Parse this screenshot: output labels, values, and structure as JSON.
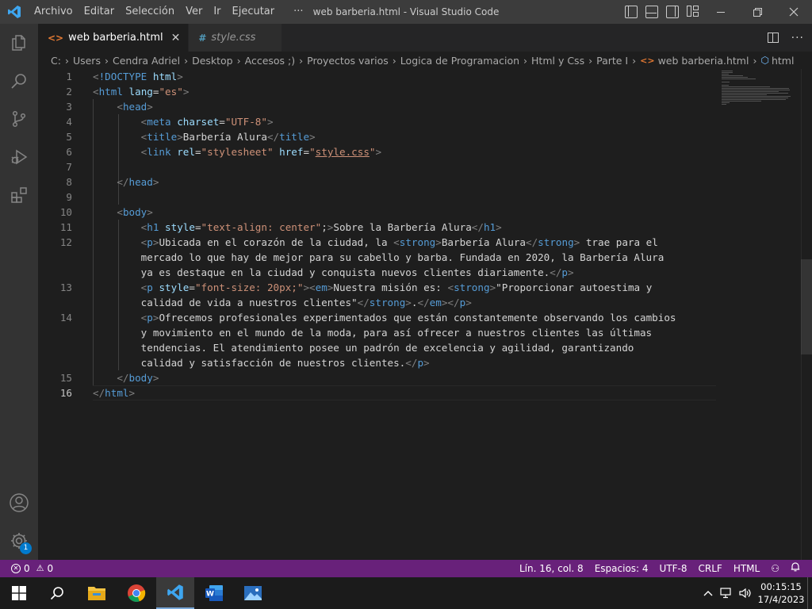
{
  "titlebar": {
    "title": "web barberia.html - Visual Studio Code",
    "menus": [
      "Archivo",
      "Editar",
      "Selección",
      "Ver",
      "Ir",
      "Ejecutar",
      "···"
    ]
  },
  "tabs": [
    {
      "label": "web barberia.html",
      "icon": "html-file-icon",
      "active": true,
      "icon_color": "#e37933"
    },
    {
      "label": "style.css",
      "icon": "css-file-icon",
      "active": false,
      "icon_color": "#519aba"
    }
  ],
  "breadcrumb": [
    "C:",
    "Users",
    "Cendra Adriel",
    "Desktop",
    "Accesos ;)",
    "Proyectos varios",
    "Logica de Programacion",
    "Html y Css",
    "Parte I",
    "web barberia.html",
    "html"
  ],
  "code": {
    "current_line": 16,
    "lines": [
      {
        "n": "1",
        "tokens": [
          [
            "br",
            "<"
          ],
          [
            "tg",
            "!DOCTYPE"
          ],
          [
            "tx",
            " "
          ],
          [
            "at",
            "html"
          ],
          [
            "br",
            ">"
          ]
        ]
      },
      {
        "n": "2",
        "tokens": [
          [
            "br",
            "<"
          ],
          [
            "tg",
            "html"
          ],
          [
            "tx",
            " "
          ],
          [
            "at",
            "lang"
          ],
          [
            "tx",
            "="
          ],
          [
            "st",
            "\"es\""
          ],
          [
            "br",
            ">"
          ]
        ]
      },
      {
        "n": "3",
        "tokens": [
          [
            "tx",
            "    "
          ],
          [
            "br",
            "<"
          ],
          [
            "tg",
            "head"
          ],
          [
            "br",
            ">"
          ]
        ]
      },
      {
        "n": "4",
        "tokens": [
          [
            "tx",
            "        "
          ],
          [
            "br",
            "<"
          ],
          [
            "tg",
            "meta"
          ],
          [
            "tx",
            " "
          ],
          [
            "at",
            "charset"
          ],
          [
            "tx",
            "="
          ],
          [
            "st",
            "\"UTF-8\""
          ],
          [
            "br",
            ">"
          ]
        ]
      },
      {
        "n": "5",
        "tokens": [
          [
            "tx",
            "        "
          ],
          [
            "br",
            "<"
          ],
          [
            "tg",
            "title"
          ],
          [
            "br",
            ">"
          ],
          [
            "tx",
            "Barbería Alura"
          ],
          [
            "br",
            "</"
          ],
          [
            "tg",
            "title"
          ],
          [
            "br",
            ">"
          ]
        ]
      },
      {
        "n": "6",
        "tokens": [
          [
            "tx",
            "        "
          ],
          [
            "br",
            "<"
          ],
          [
            "tg",
            "link"
          ],
          [
            "tx",
            " "
          ],
          [
            "at",
            "rel"
          ],
          [
            "tx",
            "="
          ],
          [
            "st",
            "\"stylesheet\""
          ],
          [
            "tx",
            " "
          ],
          [
            "at",
            "href"
          ],
          [
            "tx",
            "="
          ],
          [
            "st",
            "\""
          ],
          [
            "st ul",
            "style.css"
          ],
          [
            "st",
            "\""
          ],
          [
            "br",
            ">"
          ]
        ]
      },
      {
        "n": "7",
        "tokens": []
      },
      {
        "n": "8",
        "tokens": [
          [
            "tx",
            "    "
          ],
          [
            "br",
            "</"
          ],
          [
            "tg",
            "head"
          ],
          [
            "br",
            ">"
          ]
        ]
      },
      {
        "n": "9",
        "tokens": []
      },
      {
        "n": "10",
        "tokens": [
          [
            "tx",
            "    "
          ],
          [
            "br",
            "<"
          ],
          [
            "tg",
            "body"
          ],
          [
            "br",
            ">"
          ]
        ]
      },
      {
        "n": "11",
        "tokens": [
          [
            "tx",
            "        "
          ],
          [
            "br",
            "<"
          ],
          [
            "tg",
            "h1"
          ],
          [
            "tx",
            " "
          ],
          [
            "at",
            "style"
          ],
          [
            "tx",
            "="
          ],
          [
            "st",
            "\"text-align: center\""
          ],
          [
            "tx",
            ";"
          ],
          [
            "br",
            ">"
          ],
          [
            "tx",
            "Sobre la Barbería Alura"
          ],
          [
            "br",
            "</"
          ],
          [
            "tg",
            "h1"
          ],
          [
            "br",
            ">"
          ]
        ]
      },
      {
        "n": "12",
        "tokens": [
          [
            "tx",
            "        "
          ],
          [
            "br",
            "<"
          ],
          [
            "tg",
            "p"
          ],
          [
            "br",
            ">"
          ],
          [
            "tx",
            "Ubicada en el corazón de la ciudad, la "
          ],
          [
            "br",
            "<"
          ],
          [
            "tg",
            "strong"
          ],
          [
            "br",
            ">"
          ],
          [
            "tx",
            "Barbería Alura"
          ],
          [
            "br",
            "</"
          ],
          [
            "tg",
            "strong"
          ],
          [
            "br",
            ">"
          ],
          [
            "tx",
            " trae para el"
          ]
        ]
      },
      {
        "n": "",
        "tokens": [
          [
            "tx",
            "        mercado lo que hay de mejor para su cabello y barba. Fundada en 2020, la Barbería Alura"
          ]
        ]
      },
      {
        "n": "",
        "tokens": [
          [
            "tx",
            "        ya es destaque en la ciudad y conquista nuevos clientes diariamente."
          ],
          [
            "br",
            "</"
          ],
          [
            "tg",
            "p"
          ],
          [
            "br",
            ">"
          ]
        ]
      },
      {
        "n": "13",
        "tokens": [
          [
            "tx",
            "        "
          ],
          [
            "br",
            "<"
          ],
          [
            "tg",
            "p"
          ],
          [
            "tx",
            " "
          ],
          [
            "at",
            "style"
          ],
          [
            "tx",
            "="
          ],
          [
            "st",
            "\"font-size: 20px;\""
          ],
          [
            "br",
            ">"
          ],
          [
            "br",
            "<"
          ],
          [
            "tg",
            "em"
          ],
          [
            "br",
            ">"
          ],
          [
            "tx",
            "Nuestra misión es: "
          ],
          [
            "br",
            "<"
          ],
          [
            "tg",
            "strong"
          ],
          [
            "br",
            ">"
          ],
          [
            "tx",
            "\"Proporcionar autoestima y"
          ]
        ]
      },
      {
        "n": "",
        "tokens": [
          [
            "tx",
            "        calidad de vida a nuestros clientes\""
          ],
          [
            "br",
            "</"
          ],
          [
            "tg",
            "strong"
          ],
          [
            "br",
            ">"
          ],
          [
            "tx",
            "."
          ],
          [
            "br",
            "</"
          ],
          [
            "tg",
            "em"
          ],
          [
            "br",
            ">"
          ],
          [
            "br",
            "</"
          ],
          [
            "tg",
            "p"
          ],
          [
            "br",
            ">"
          ]
        ]
      },
      {
        "n": "14",
        "tokens": [
          [
            "tx",
            "        "
          ],
          [
            "br",
            "<"
          ],
          [
            "tg",
            "p"
          ],
          [
            "br",
            ">"
          ],
          [
            "tx",
            "Ofrecemos profesionales experimentados que están constantemente observando los cambios"
          ]
        ]
      },
      {
        "n": "",
        "tokens": [
          [
            "tx",
            "        y movimiento en el mundo de la moda, para así ofrecer a nuestros clientes las últimas"
          ]
        ]
      },
      {
        "n": "",
        "tokens": [
          [
            "tx",
            "        tendencias. El atendimiento posee un padrón de excelencia y agilidad, garantizando"
          ]
        ]
      },
      {
        "n": "",
        "tokens": [
          [
            "tx",
            "        calidad y satisfacción de nuestros clientes."
          ],
          [
            "br",
            "</"
          ],
          [
            "tg",
            "p"
          ],
          [
            "br",
            ">"
          ]
        ]
      },
      {
        "n": "15",
        "tokens": [
          [
            "tx",
            "    "
          ],
          [
            "br",
            "</"
          ],
          [
            "tg",
            "body"
          ],
          [
            "br",
            ">"
          ]
        ]
      },
      {
        "n": "16",
        "tokens": [
          [
            "br",
            "</"
          ],
          [
            "tg",
            "html"
          ],
          [
            "br",
            ">"
          ]
        ]
      }
    ]
  },
  "statusbar": {
    "errors": "0",
    "warnings": "0",
    "position": "Lín. 16, col. 8",
    "spaces": "Espacios: 4",
    "encoding": "UTF-8",
    "eol": "CRLF",
    "language": "HTML",
    "color": "#68217a"
  },
  "activitybar": {
    "items": [
      "explorer-icon",
      "search-icon",
      "source-control-icon",
      "run-debug-icon",
      "extensions-icon"
    ],
    "bottom": [
      "accounts-icon",
      "manage-gear-icon"
    ],
    "badge": "1"
  },
  "taskbar": {
    "apps": [
      "file-explorer-icon",
      "chrome-icon",
      "vscode-icon",
      "word-icon",
      "photos-icon"
    ],
    "time": "00:15:15",
    "date": "17/4/2023"
  }
}
